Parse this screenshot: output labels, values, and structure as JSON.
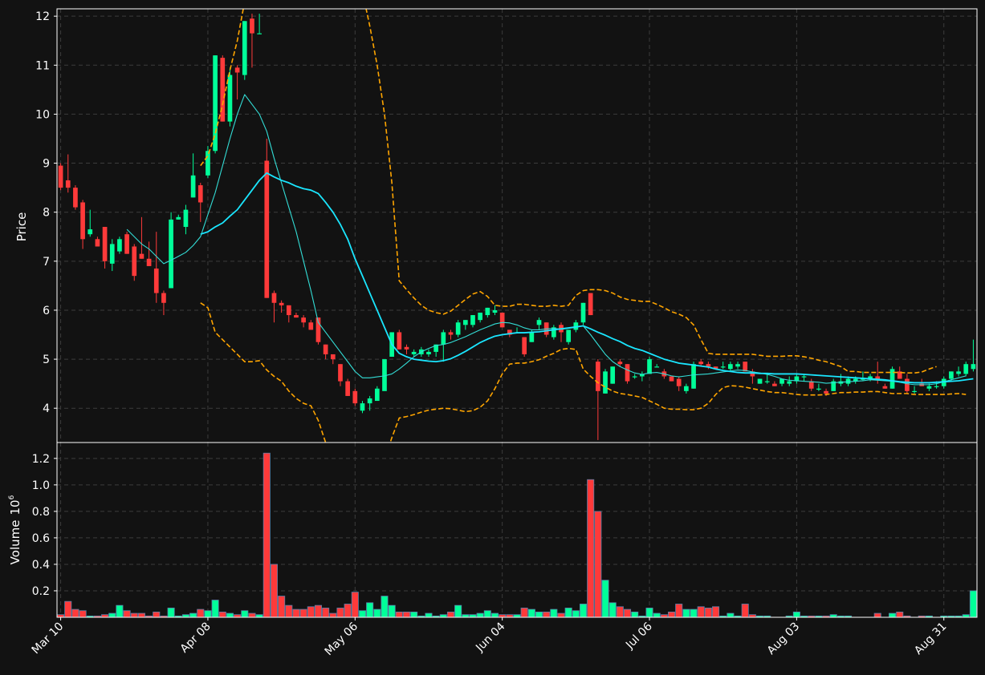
{
  "chart_data": {
    "type": "candlestick",
    "price_panel": {
      "ylabel": "Price",
      "ylim": [
        3.3,
        12.15
      ],
      "yticks": [
        "4",
        "5",
        "6",
        "7",
        "8",
        "9",
        "10",
        "11",
        "12"
      ],
      "ytick_values": [
        4,
        5,
        6,
        7,
        8,
        9,
        10,
        11,
        12
      ]
    },
    "volume_panel": {
      "ylabel": "Volume",
      "ylabel_exponent": "6",
      "ylim": [
        0,
        1.32
      ],
      "yticks": [
        "0.2",
        "0.4",
        "0.6",
        "0.8",
        "1.0",
        "1.2"
      ],
      "ytick_values": [
        0.2,
        0.4,
        0.6,
        0.8,
        1.0,
        1.2
      ]
    },
    "x_ticks": [
      {
        "label": "Mar 10",
        "index": 0
      },
      {
        "label": "Apr 08",
        "index": 20
      },
      {
        "label": "May 06",
        "index": 40
      },
      {
        "label": "Jun 04",
        "index": 60
      },
      {
        "label": "Jul 06",
        "index": 80
      },
      {
        "label": "Aug 03",
        "index": 100
      },
      {
        "label": "Aug 31",
        "index": 120
      }
    ],
    "candles": [
      [
        8.95,
        9.0,
        8.45,
        8.5,
        0.02
      ],
      [
        8.65,
        9.18,
        8.4,
        8.5,
        0.12
      ],
      [
        8.5,
        8.55,
        8.05,
        8.1,
        0.06
      ],
      [
        8.2,
        8.25,
        7.25,
        7.45,
        0.05
      ],
      [
        7.55,
        8.05,
        7.5,
        7.65,
        0.01
      ],
      [
        7.45,
        7.5,
        7.3,
        7.3,
        0.01
      ],
      [
        7.7,
        7.7,
        6.85,
        7.0,
        0.02
      ],
      [
        6.95,
        7.45,
        6.8,
        7.35,
        0.03
      ],
      [
        7.2,
        7.5,
        7.15,
        7.45,
        0.09
      ],
      [
        7.55,
        7.6,
        7.15,
        7.15,
        0.05
      ],
      [
        7.3,
        7.35,
        6.6,
        6.7,
        0.03
      ],
      [
        7.15,
        7.9,
        7.05,
        7.05,
        0.03
      ],
      [
        7.05,
        7.4,
        6.9,
        6.9,
        0.01
      ],
      [
        6.85,
        7.6,
        6.15,
        6.35,
        0.04
      ],
      [
        6.35,
        6.4,
        5.9,
        6.15,
        0.01
      ],
      [
        6.45,
        8.0,
        6.45,
        7.85,
        0.07
      ],
      [
        7.85,
        7.95,
        7.85,
        7.9,
        0.01
      ],
      [
        7.7,
        8.15,
        7.55,
        8.05,
        0.02
      ],
      [
        8.3,
        9.2,
        8.3,
        8.75,
        0.03
      ],
      [
        8.55,
        8.6,
        7.8,
        8.2,
        0.06
      ],
      [
        8.75,
        9.35,
        8.7,
        9.25,
        0.05
      ],
      [
        9.25,
        11.2,
        9.2,
        11.2,
        0.13
      ],
      [
        11.15,
        11.2,
        9.85,
        9.85,
        0.04
      ],
      [
        9.85,
        10.95,
        9.75,
        10.8,
        0.03
      ],
      [
        10.95,
        11.0,
        10.3,
        10.85,
        0.02
      ],
      [
        10.8,
        11.9,
        10.7,
        11.9,
        0.05
      ],
      [
        11.95,
        12.05,
        10.95,
        11.65,
        0.03
      ],
      [
        11.65,
        12.05,
        11.65,
        11.65,
        0.02
      ],
      [
        9.05,
        9.5,
        6.25,
        6.25,
        1.24
      ],
      [
        6.35,
        6.4,
        5.75,
        6.15,
        0.4
      ],
      [
        6.15,
        6.2,
        5.95,
        6.1,
        0.16
      ],
      [
        6.1,
        6.1,
        5.75,
        5.9,
        0.09
      ],
      [
        5.9,
        5.95,
        5.85,
        5.85,
        0.06
      ],
      [
        5.85,
        5.9,
        5.65,
        5.75,
        0.06
      ],
      [
        5.75,
        5.8,
        5.6,
        5.6,
        0.08
      ],
      [
        5.85,
        5.85,
        5.3,
        5.35,
        0.09
      ],
      [
        5.3,
        5.3,
        5.0,
        5.1,
        0.07
      ],
      [
        5.1,
        5.1,
        4.9,
        5.0,
        0.03
      ],
      [
        4.9,
        4.9,
        4.45,
        4.55,
        0.07
      ],
      [
        4.55,
        4.6,
        4.25,
        4.25,
        0.1
      ],
      [
        4.35,
        4.4,
        4.05,
        4.1,
        0.19
      ],
      [
        3.95,
        4.15,
        3.9,
        4.1,
        0.05
      ],
      [
        4.1,
        4.25,
        3.95,
        4.2,
        0.11
      ],
      [
        4.15,
        4.45,
        4.15,
        4.4,
        0.06
      ],
      [
        4.35,
        4.35,
        4.35,
        5.0,
        0.16
      ],
      [
        5.05,
        5.55,
        5.05,
        5.55,
        0.09
      ],
      [
        5.55,
        5.6,
        5.2,
        5.2,
        0.04
      ],
      [
        5.25,
        5.3,
        5.1,
        5.2,
        0.04
      ],
      [
        5.1,
        5.2,
        5.05,
        5.15,
        0.04
      ],
      [
        5.1,
        5.25,
        5.05,
        5.2,
        0.01
      ],
      [
        5.1,
        5.2,
        5.05,
        5.15,
        0.03
      ],
      [
        5.15,
        5.3,
        5.05,
        5.3,
        0.01
      ],
      [
        5.3,
        5.6,
        4.95,
        5.55,
        0.02
      ],
      [
        5.55,
        5.6,
        5.4,
        5.5,
        0.04
      ],
      [
        5.5,
        5.8,
        5.45,
        5.75,
        0.09
      ],
      [
        5.7,
        5.8,
        5.6,
        5.8,
        0.02
      ],
      [
        5.7,
        5.9,
        5.65,
        5.9,
        0.02
      ],
      [
        5.8,
        5.95,
        5.75,
        5.95,
        0.03
      ],
      [
        5.9,
        6.05,
        5.85,
        6.05,
        0.05
      ],
      [
        5.95,
        6.1,
        5.9,
        6.0,
        0.03
      ],
      [
        5.95,
        5.95,
        5.65,
        5.65,
        0.02
      ],
      [
        5.6,
        5.6,
        5.45,
        5.5,
        0.02
      ],
      [
        5.55,
        5.65,
        5.55,
        5.55,
        0.02
      ],
      [
        5.45,
        5.45,
        5.05,
        5.1,
        0.07
      ],
      [
        5.35,
        5.6,
        5.35,
        5.55,
        0.06
      ],
      [
        5.7,
        5.85,
        5.6,
        5.8,
        0.04
      ],
      [
        5.75,
        5.75,
        5.45,
        5.5,
        0.04
      ],
      [
        5.45,
        5.7,
        5.4,
        5.65,
        0.06
      ],
      [
        5.7,
        5.75,
        5.35,
        5.55,
        0.03
      ],
      [
        5.35,
        5.6,
        5.3,
        5.6,
        0.07
      ],
      [
        5.6,
        5.8,
        5.55,
        5.75,
        0.05
      ],
      [
        5.75,
        6.15,
        5.7,
        6.15,
        0.1
      ],
      [
        6.35,
        6.35,
        5.9,
        5.9,
        1.04
      ],
      [
        4.95,
        5.0,
        3.35,
        4.35,
        0.8
      ],
      [
        4.3,
        4.8,
        4.3,
        4.75,
        0.28
      ],
      [
        4.5,
        4.85,
        4.5,
        4.85,
        0.11
      ],
      [
        4.95,
        5.0,
        4.85,
        4.9,
        0.08
      ],
      [
        4.9,
        4.9,
        4.5,
        4.55,
        0.06
      ],
      [
        4.65,
        4.7,
        4.6,
        4.65,
        0.04
      ],
      [
        4.65,
        4.75,
        4.55,
        4.7,
        0.01
      ],
      [
        4.7,
        5.05,
        4.7,
        5.0,
        0.07
      ],
      [
        4.85,
        4.9,
        4.85,
        4.85,
        0.03
      ],
      [
        4.75,
        4.8,
        4.6,
        4.65,
        0.02
      ],
      [
        4.65,
        4.65,
        4.55,
        4.55,
        0.04
      ],
      [
        4.6,
        4.65,
        4.35,
        4.45,
        0.1
      ],
      [
        4.35,
        4.5,
        4.3,
        4.45,
        0.06
      ],
      [
        4.4,
        4.95,
        4.4,
        4.9,
        0.06
      ],
      [
        4.95,
        5.0,
        4.85,
        4.9,
        0.08
      ],
      [
        4.9,
        4.95,
        4.8,
        4.85,
        0.07
      ],
      [
        4.85,
        4.85,
        4.8,
        4.8,
        0.08
      ],
      [
        4.85,
        4.95,
        4.8,
        4.85,
        0.01
      ],
      [
        4.8,
        4.95,
        4.75,
        4.9,
        0.03
      ],
      [
        4.85,
        4.95,
        4.8,
        4.9,
        0.01
      ],
      [
        4.95,
        4.95,
        4.75,
        4.75,
        0.1
      ],
      [
        4.75,
        4.8,
        4.5,
        4.65,
        0.02
      ],
      [
        4.5,
        4.6,
        4.5,
        4.6,
        0.01
      ],
      [
        4.55,
        4.7,
        4.5,
        4.55,
        0.01
      ],
      [
        4.5,
        4.55,
        4.45,
        4.45,
        0.0
      ],
      [
        4.5,
        4.6,
        4.45,
        4.6,
        0.0
      ],
      [
        4.5,
        4.65,
        4.45,
        4.55,
        0.01
      ],
      [
        4.55,
        4.7,
        4.5,
        4.65,
        0.04
      ],
      [
        4.65,
        4.7,
        4.55,
        4.65,
        0.01
      ],
      [
        4.55,
        4.6,
        4.35,
        4.4,
        0.01
      ],
      [
        4.4,
        4.5,
        4.35,
        4.4,
        0.01
      ],
      [
        4.35,
        4.4,
        4.25,
        4.3,
        0.01
      ],
      [
        4.35,
        4.6,
        4.35,
        4.55,
        0.02
      ],
      [
        4.5,
        4.7,
        4.45,
        4.55,
        0.01
      ],
      [
        4.5,
        4.65,
        4.45,
        4.6,
        0.01
      ],
      [
        4.55,
        4.65,
        4.5,
        4.6,
        0.0
      ],
      [
        4.6,
        4.75,
        4.55,
        4.6,
        0.0
      ],
      [
        4.6,
        4.7,
        4.55,
        4.65,
        0.0
      ],
      [
        4.65,
        4.95,
        4.5,
        4.6,
        0.03
      ],
      [
        4.45,
        4.5,
        4.4,
        4.4,
        0.0
      ],
      [
        4.4,
        4.85,
        4.4,
        4.8,
        0.03
      ],
      [
        4.75,
        4.85,
        4.6,
        4.6,
        0.04
      ],
      [
        4.6,
        4.7,
        4.3,
        4.35,
        0.01
      ],
      [
        4.35,
        4.45,
        4.3,
        4.35,
        0.0
      ],
      [
        4.5,
        4.6,
        4.45,
        4.45,
        0.01
      ],
      [
        4.4,
        4.5,
        4.35,
        4.45,
        0.01
      ],
      [
        4.45,
        4.55,
        4.4,
        4.45,
        0.0
      ],
      [
        4.45,
        4.65,
        4.4,
        4.6,
        0.01
      ],
      [
        4.6,
        4.75,
        4.55,
        4.75,
        0.01
      ],
      [
        4.7,
        4.85,
        4.65,
        4.75,
        0.01
      ],
      [
        4.7,
        4.95,
        4.65,
        4.9,
        0.02
      ],
      [
        4.8,
        5.4,
        4.75,
        4.9,
        0.2
      ]
    ],
    "sma_short": [
      null,
      null,
      null,
      null,
      null,
      null,
      null,
      null,
      null,
      7.65,
      7.5,
      7.35,
      7.25,
      7.1,
      6.95,
      7.02,
      7.1,
      7.18,
      7.32,
      7.5,
      7.95,
      8.4,
      8.95,
      9.5,
      10.0,
      10.4,
      10.2,
      10.0,
      9.65,
      9.1,
      8.6,
      8.1,
      7.6,
      7.0,
      6.4,
      5.75,
      5.55,
      5.35,
      5.15,
      4.95,
      4.75,
      4.62,
      4.62,
      4.64,
      4.66,
      4.7,
      4.8,
      4.92,
      5.05,
      5.15,
      5.22,
      5.28,
      5.3,
      5.34,
      5.4,
      5.46,
      5.53,
      5.6,
      5.66,
      5.72,
      5.75,
      5.74,
      5.7,
      5.64,
      5.6,
      5.6,
      5.62,
      5.63,
      5.61,
      5.63,
      5.65,
      5.68,
      5.5,
      5.3,
      5.1,
      4.95,
      4.85,
      4.78,
      4.72,
      4.69,
      4.72,
      4.73,
      4.7,
      4.66,
      4.64,
      4.66,
      4.68,
      4.69,
      4.7,
      4.72,
      4.74,
      4.76,
      4.78,
      4.77,
      4.74,
      4.72,
      4.69,
      4.65,
      4.6,
      4.57,
      4.56,
      4.55,
      4.54,
      4.53,
      4.51,
      4.52,
      4.53,
      4.54,
      4.55,
      4.56,
      4.58,
      4.57,
      4.56,
      4.55,
      4.53,
      4.5,
      4.48,
      4.48,
      4.48,
      4.5,
      4.54,
      4.58,
      4.62,
      4.66
    ],
    "sma_long": [
      null,
      null,
      null,
      null,
      null,
      null,
      null,
      null,
      null,
      null,
      null,
      null,
      null,
      null,
      null,
      null,
      null,
      null,
      null,
      7.55,
      7.6,
      7.7,
      7.78,
      7.92,
      8.05,
      8.25,
      8.45,
      8.65,
      8.8,
      8.72,
      8.65,
      8.6,
      8.53,
      8.48,
      8.45,
      8.38,
      8.2,
      8.0,
      7.75,
      7.45,
      7.05,
      6.7,
      6.35,
      6.0,
      5.65,
      5.3,
      5.12,
      5.05,
      5.0,
      4.98,
      4.96,
      4.95,
      4.97,
      5.01,
      5.08,
      5.16,
      5.25,
      5.34,
      5.41,
      5.47,
      5.5,
      5.52,
      5.54,
      5.54,
      5.55,
      5.56,
      5.58,
      5.6,
      5.62,
      5.64,
      5.66,
      5.68,
      5.62,
      5.55,
      5.49,
      5.42,
      5.36,
      5.28,
      5.22,
      5.18,
      5.12,
      5.06,
      5.0,
      4.96,
      4.92,
      4.9,
      4.88,
      4.86,
      4.84,
      4.8,
      4.77,
      4.75,
      4.73,
      4.72,
      4.72,
      4.71,
      4.71,
      4.7,
      4.7,
      4.7,
      4.7,
      4.69,
      4.68,
      4.67,
      4.66,
      4.65,
      4.64,
      4.63,
      4.62,
      4.61,
      4.6,
      4.59,
      4.58,
      4.56,
      4.54,
      4.53,
      4.52,
      4.52,
      4.52,
      4.53,
      4.54,
      4.55,
      4.56,
      4.58,
      4.6
    ],
    "band_upper": [
      null,
      null,
      null,
      null,
      null,
      null,
      null,
      null,
      null,
      null,
      null,
      null,
      null,
      null,
      null,
      null,
      null,
      null,
      null,
      8.95,
      9.15,
      9.6,
      10.2,
      10.9,
      11.5,
      12.3,
      12.5,
      12.5,
      12.5,
      12.5,
      12.5,
      12.5,
      12.5,
      12.5,
      12.5,
      12.5,
      12.5,
      12.5,
      12.5,
      12.5,
      12.5,
      12.5,
      11.8,
      11.0,
      10.0,
      8.6,
      6.6,
      6.42,
      6.25,
      6.1,
      6.0,
      5.95,
      5.92,
      5.98,
      6.1,
      6.22,
      6.33,
      6.38,
      6.28,
      6.1,
      6.08,
      6.08,
      6.12,
      6.12,
      6.1,
      6.08,
      6.08,
      6.1,
      6.08,
      6.1,
      6.3,
      6.4,
      6.42,
      6.42,
      6.4,
      6.35,
      6.27,
      6.22,
      6.2,
      6.18,
      6.18,
      6.12,
      6.05,
      5.97,
      5.92,
      5.85,
      5.7,
      5.4,
      5.12,
      5.1,
      5.1,
      5.1,
      5.1,
      5.1,
      5.1,
      5.08,
      5.06,
      5.06,
      5.06,
      5.07,
      5.07,
      5.05,
      5.02,
      4.98,
      4.95,
      4.9,
      4.85,
      4.75,
      4.75,
      4.73,
      4.73,
      4.73,
      4.73,
      4.73,
      4.73,
      4.72,
      4.72,
      4.74,
      4.8,
      4.85
    ],
    "band_lower": [
      null,
      null,
      null,
      null,
      null,
      null,
      null,
      null,
      null,
      null,
      null,
      null,
      null,
      null,
      null,
      null,
      null,
      null,
      null,
      6.15,
      6.05,
      5.55,
      5.4,
      5.25,
      5.1,
      4.95,
      4.95,
      4.97,
      4.78,
      4.65,
      4.55,
      4.35,
      4.2,
      4.1,
      4.05,
      3.75,
      3.3,
      2.9,
      2.6,
      2.3,
      2.1,
      2.0,
      2.2,
      2.55,
      2.95,
      3.4,
      3.8,
      3.83,
      3.87,
      3.92,
      3.96,
      3.98,
      4.0,
      3.99,
      3.96,
      3.93,
      3.95,
      4.02,
      4.15,
      4.4,
      4.7,
      4.9,
      4.92,
      4.92,
      4.95,
      4.99,
      5.06,
      5.12,
      5.2,
      5.22,
      5.2,
      4.8,
      4.65,
      4.52,
      4.43,
      4.35,
      4.3,
      4.28,
      4.25,
      4.22,
      4.15,
      4.08,
      4.0,
      3.98,
      3.98,
      3.97,
      3.97,
      4.0,
      4.1,
      4.28,
      4.42,
      4.46,
      4.45,
      4.43,
      4.4,
      4.37,
      4.34,
      4.32,
      4.32,
      4.3,
      4.28,
      4.27,
      4.27,
      4.27,
      4.28,
      4.3,
      4.32,
      4.32,
      4.33,
      4.33,
      4.34,
      4.34,
      4.32,
      4.3,
      4.3,
      4.3,
      4.28,
      4.28,
      4.28,
      4.28,
      4.28,
      4.29,
      4.3,
      4.28
    ],
    "colors": {
      "background": "#121212",
      "up": "#00ff99",
      "down": "#ff3a3a",
      "volume_edge": "#5a7fa8",
      "sma_short": "#33ddd6",
      "sma_long": "#1ae6ff",
      "band": "#ffa500",
      "grid": "#3c3c3c",
      "axis": "#ffffff"
    },
    "grid": true
  }
}
